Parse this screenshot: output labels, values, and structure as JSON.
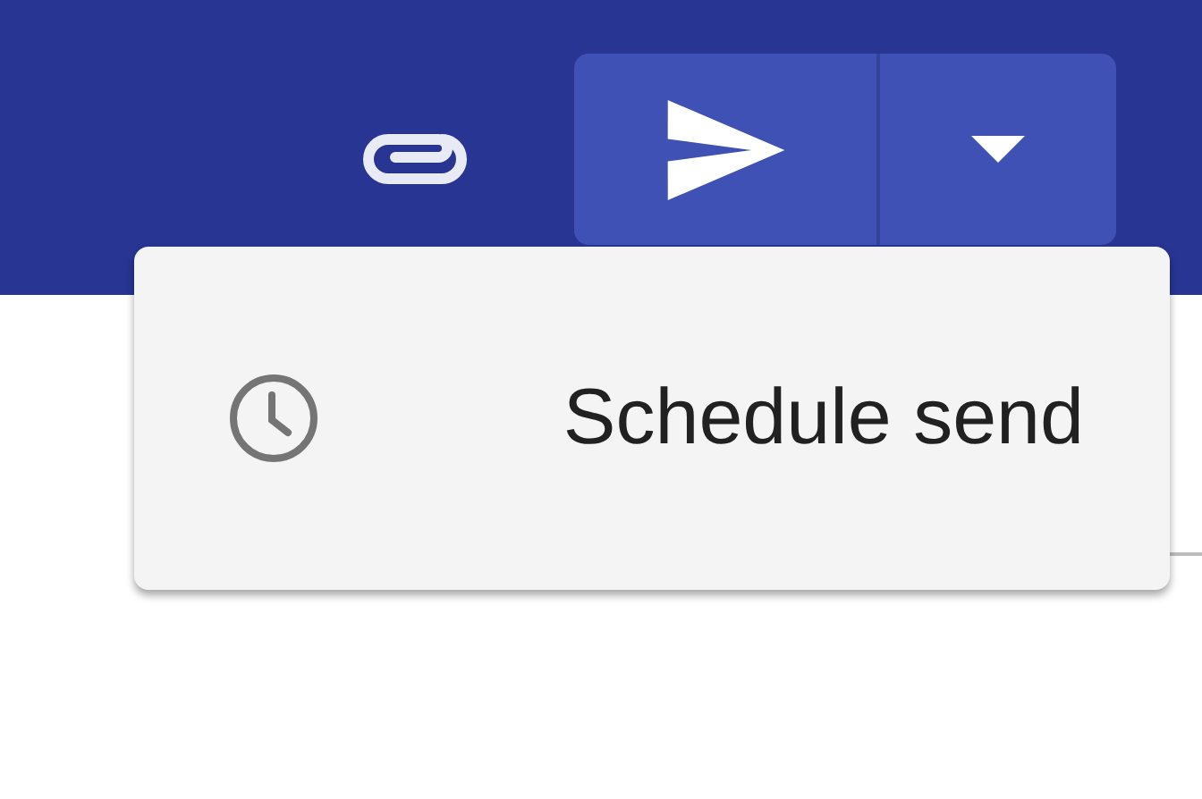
{
  "menu": {
    "items": [
      {
        "label": "Schedule send"
      }
    ]
  }
}
